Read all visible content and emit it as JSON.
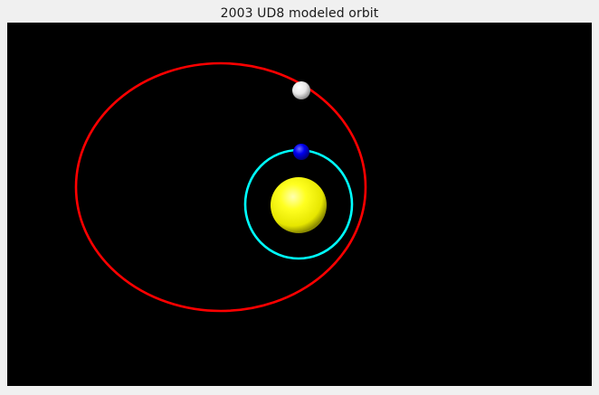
{
  "window": {
    "title": "2003 UD8 modeled orbit"
  },
  "scene": {
    "background_color": "#000000",
    "bodies": [
      {
        "name": "Sun",
        "icon": "sun-sphere",
        "color": "#ffff00"
      },
      {
        "name": "Earth",
        "icon": "earth-sphere",
        "color": "#0000ff"
      },
      {
        "name": "2003 UD8",
        "icon": "asteroid-sphere",
        "color": "#ffffff"
      }
    ],
    "orbits": [
      {
        "name": "Earth orbit",
        "color": "#00ffff"
      },
      {
        "name": "2003 UD8 orbit",
        "color": "#ff0000"
      }
    ]
  }
}
